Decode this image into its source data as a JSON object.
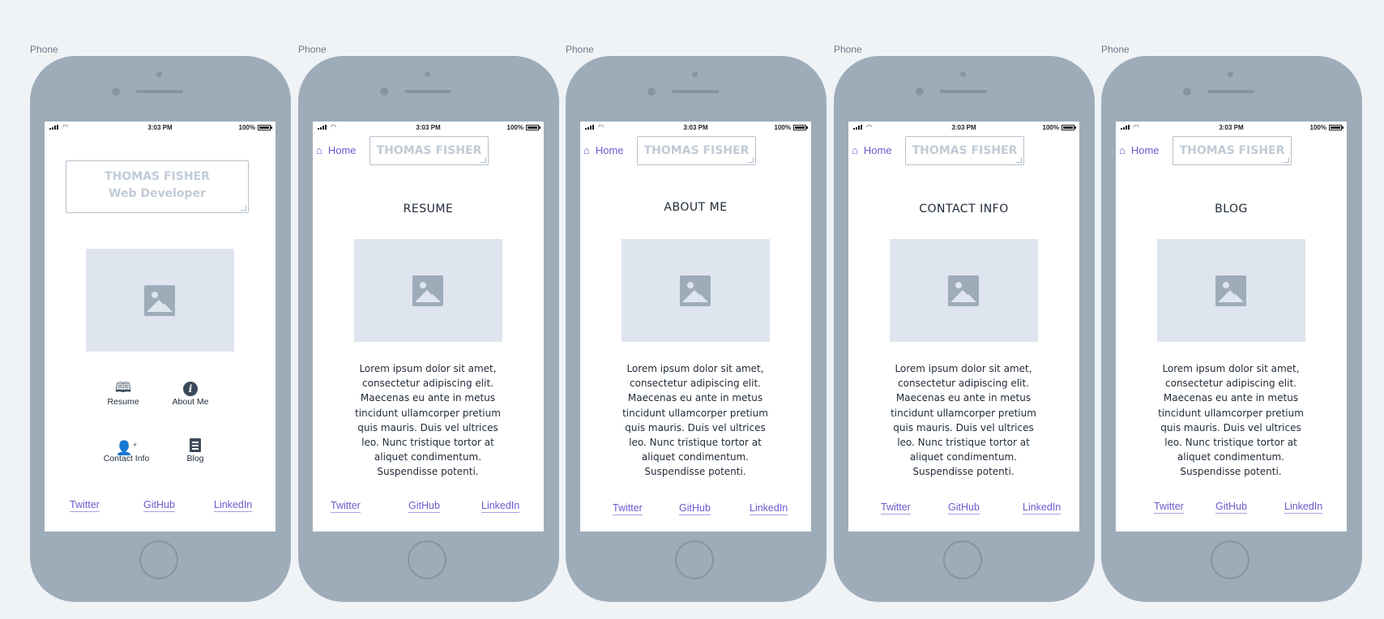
{
  "phone_label": "Phone",
  "status_bar": {
    "time": "3:03 PM",
    "battery": "100%"
  },
  "home_screen": {
    "name": "THOMAS FISHER",
    "role": "Web Developer",
    "nav": [
      {
        "label": "Resume",
        "icon": "book-icon"
      },
      {
        "label": "About Me",
        "icon": "info-icon"
      },
      {
        "label": "Contact Info",
        "icon": "add-user-icon"
      },
      {
        "label": "Blog",
        "icon": "document-icon"
      }
    ]
  },
  "header": {
    "home_label": "Home",
    "name": "THOMAS FISHER"
  },
  "pages": [
    {
      "title": "RESUME"
    },
    {
      "title": "ABOUT ME"
    },
    {
      "title": "CONTACT INFO"
    },
    {
      "title": "BLOG"
    }
  ],
  "lorem": "Lorem ipsum dolor sit amet, consectetur adipiscing elit. Maecenas eu ante in metus tincidunt ullamcorper pretium quis mauris. Duis vel ultrices leo. Nunc tristique tortor at aliquet condimentum. Suspendisse potenti.",
  "footer_links": {
    "twitter": "Twitter",
    "github": "GitHub",
    "linkedin": "LinkedIn"
  },
  "colors": {
    "background": "#eff3f6",
    "phone": "#9eacba",
    "link": "#6a5acd",
    "placeholder": "#dee5ee"
  }
}
